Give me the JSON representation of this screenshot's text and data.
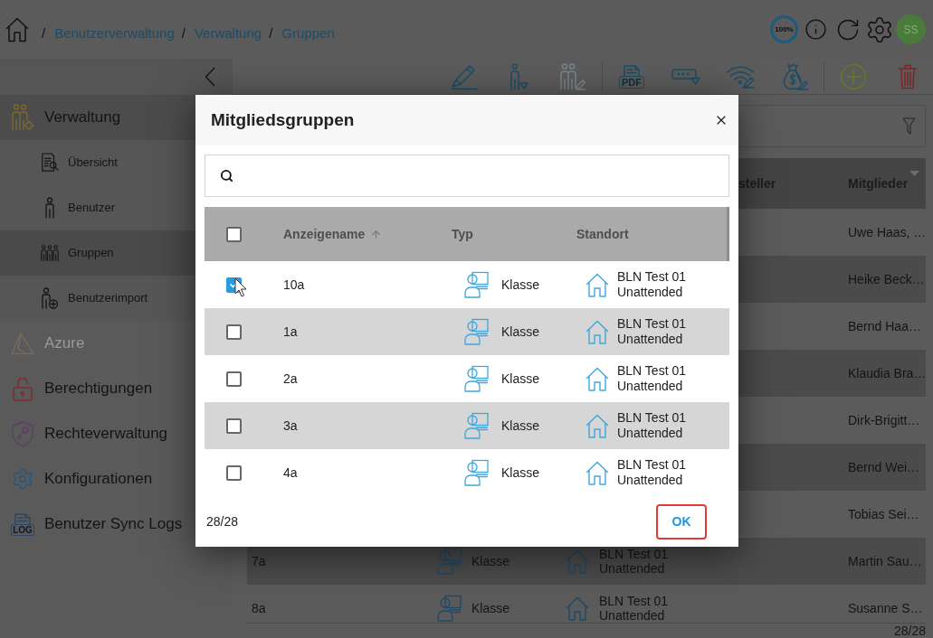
{
  "breadcrumb": [
    {
      "separator": "/",
      "label": "Benutzerverwaltung"
    },
    {
      "separator": "/",
      "label": "Verwaltung"
    },
    {
      "separator": "/",
      "label": "Gruppen"
    }
  ],
  "header": {
    "zoom": "100%",
    "avatar": "SS"
  },
  "toolbar": {
    "groups": [
      [
        {
          "kind": "edit",
          "disabled": false
        },
        {
          "kind": "assign-user",
          "disabled": false
        },
        {
          "kind": "edit-group",
          "disabled": true
        }
      ],
      [
        {
          "kind": "pdf",
          "label": "PDF",
          "disabled": false
        },
        {
          "kind": "password",
          "disabled": false
        },
        {
          "kind": "wifi",
          "disabled": false
        },
        {
          "kind": "budget",
          "disabled": false
        }
      ],
      [
        {
          "kind": "add",
          "disabled": false
        },
        {
          "kind": "delete",
          "disabled": false
        }
      ]
    ]
  },
  "sidebar": {
    "items": [
      {
        "kind": "admin",
        "label": "Verwaltung",
        "expanded": true,
        "disabled": false,
        "children": [
          {
            "kind": "overview",
            "label": "Übersicht",
            "selected": false
          },
          {
            "kind": "user",
            "label": "Benutzer",
            "selected": false
          },
          {
            "kind": "groups",
            "label": "Gruppen",
            "selected": true
          },
          {
            "kind": "import",
            "label": "Benutzerimport",
            "selected": false
          }
        ]
      },
      {
        "kind": "azure",
        "label": "Azure",
        "disabled": true
      },
      {
        "kind": "permissions",
        "label": "Berechtigungen",
        "disabled": false
      },
      {
        "kind": "rights",
        "label": "Rechteverwaltung",
        "disabled": false
      },
      {
        "kind": "config",
        "label": "Konfigurationen",
        "disabled": false
      },
      {
        "kind": "sync-logs",
        "label": "Benutzer Sync Logs",
        "icon_text": "LOG",
        "disabled": false
      }
    ]
  },
  "table": {
    "columns": [
      {
        "label": "steller"
      },
      {
        "label": "Mitglieder"
      }
    ],
    "rows": [
      {
        "members": "Uwe Haas, …"
      },
      {
        "members": "Heike Beck…"
      },
      {
        "members": "Bernd Haa…"
      },
      {
        "members": "Klaudia Bra…"
      },
      {
        "members": "Dirk-Brigitt…"
      },
      {
        "members": "Bernd Wei…"
      },
      {
        "members": "Tobias Sei…"
      },
      {
        "name": "7a",
        "type": "Klasse",
        "location": "BLN Test 01 Unattended",
        "members": "Martin Sau…"
      },
      {
        "name": "8a",
        "type": "Klasse",
        "location": "BLN Test 01 Unattended",
        "members": "Susanne S…"
      }
    ],
    "count": "28/28"
  },
  "dialog": {
    "title": "Mitgliedsgruppen",
    "select_all": {
      "checked": false
    },
    "columns": [
      {
        "label": "Anzeigename",
        "sorted": true
      },
      {
        "label": "Typ",
        "sorted": false
      },
      {
        "label": "Standort",
        "sorted": false
      }
    ],
    "rows": [
      {
        "name": "10a",
        "type": "Klasse",
        "location": "BLN Test 01 Unattended",
        "checked": true
      },
      {
        "name": "1a",
        "type": "Klasse",
        "location": "BLN Test 01 Unattended",
        "checked": false
      },
      {
        "name": "2a",
        "type": "Klasse",
        "location": "BLN Test 01 Unattended",
        "checked": false
      },
      {
        "name": "3a",
        "type": "Klasse",
        "location": "BLN Test 01 Unattended",
        "checked": false
      },
      {
        "name": "4a",
        "type": "Klasse",
        "location": "BLN Test 01 Unattended",
        "checked": false
      }
    ],
    "count": "28/28",
    "ok_button": {
      "label": "OK",
      "highlighted": true
    }
  }
}
